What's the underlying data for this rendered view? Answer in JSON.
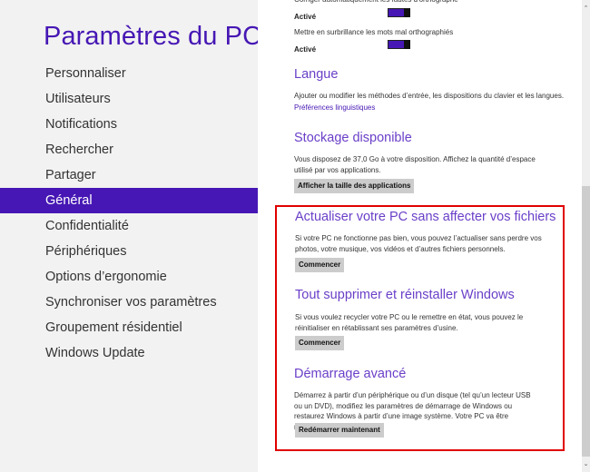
{
  "sidebar": {
    "title": "Paramètres du PC",
    "items": [
      {
        "label": "Personnaliser",
        "active": false
      },
      {
        "label": "Utilisateurs",
        "active": false
      },
      {
        "label": "Notifications",
        "active": false
      },
      {
        "label": "Rechercher",
        "active": false
      },
      {
        "label": "Partager",
        "active": false
      },
      {
        "label": "Général",
        "active": true
      },
      {
        "label": "Confidentialité",
        "active": false
      },
      {
        "label": "Périphériques",
        "active": false
      },
      {
        "label": "Options d’ergonomie",
        "active": false
      },
      {
        "label": "Synchroniser vos paramètres",
        "active": false
      },
      {
        "label": "Groupement résidentiel",
        "active": false
      },
      {
        "label": "Windows Update",
        "active": false
      }
    ],
    "accent_color": "#4617b4"
  },
  "content": {
    "spelling": {
      "autocorrect_label": "Corriger automatiquement les fautes d'orthographe",
      "autocorrect_state": "Activé",
      "autocorrect_on": true,
      "highlight_label": "Mettre en surbrillance les mots mal orthographiés",
      "highlight_state": "Activé",
      "highlight_on": true
    },
    "language": {
      "title": "Langue",
      "description": "Ajouter ou modifier les méthodes d’entrée, les dispositions du clavier et les langues.",
      "link": "Préférences linguistiques"
    },
    "storage": {
      "title": "Stockage disponible",
      "description": "Vous disposez de 37,0 Go à votre disposition. Affichez la quantité d’espace utilisé par vos applications.",
      "button": "Afficher la taille des applications"
    },
    "refresh": {
      "title": "Actualiser votre PC sans affecter vos fichiers",
      "description": "Si votre PC ne fonctionne pas bien, vous pouvez l’actualiser sans perdre vos photos, votre musique, vos vidéos et d’autres fichiers personnels.",
      "button": "Commencer"
    },
    "reset": {
      "title": "Tout supprimer et réinstaller Windows",
      "description": "Si vous voulez recycler votre PC ou le remettre en état, vous pouvez le réinitialiser en rétablissant ses paramètres d’usine.",
      "button": "Commencer"
    },
    "advanced_startup": {
      "title": "Démarrage avancé",
      "description": "Démarrez à partir d’un périphérique ou d’un disque (tel qu’un lecteur USB ou un DVD), modifiez les paramètres de démarrage de Windows ou restaurez Windows à partir d’une image système. Votre PC va être redémarré.",
      "button": "Redémarrer maintenant"
    },
    "highlight_color": "#e00000"
  },
  "scrollbar": {
    "up_icon": "⌃",
    "down_icon": "⌄"
  }
}
